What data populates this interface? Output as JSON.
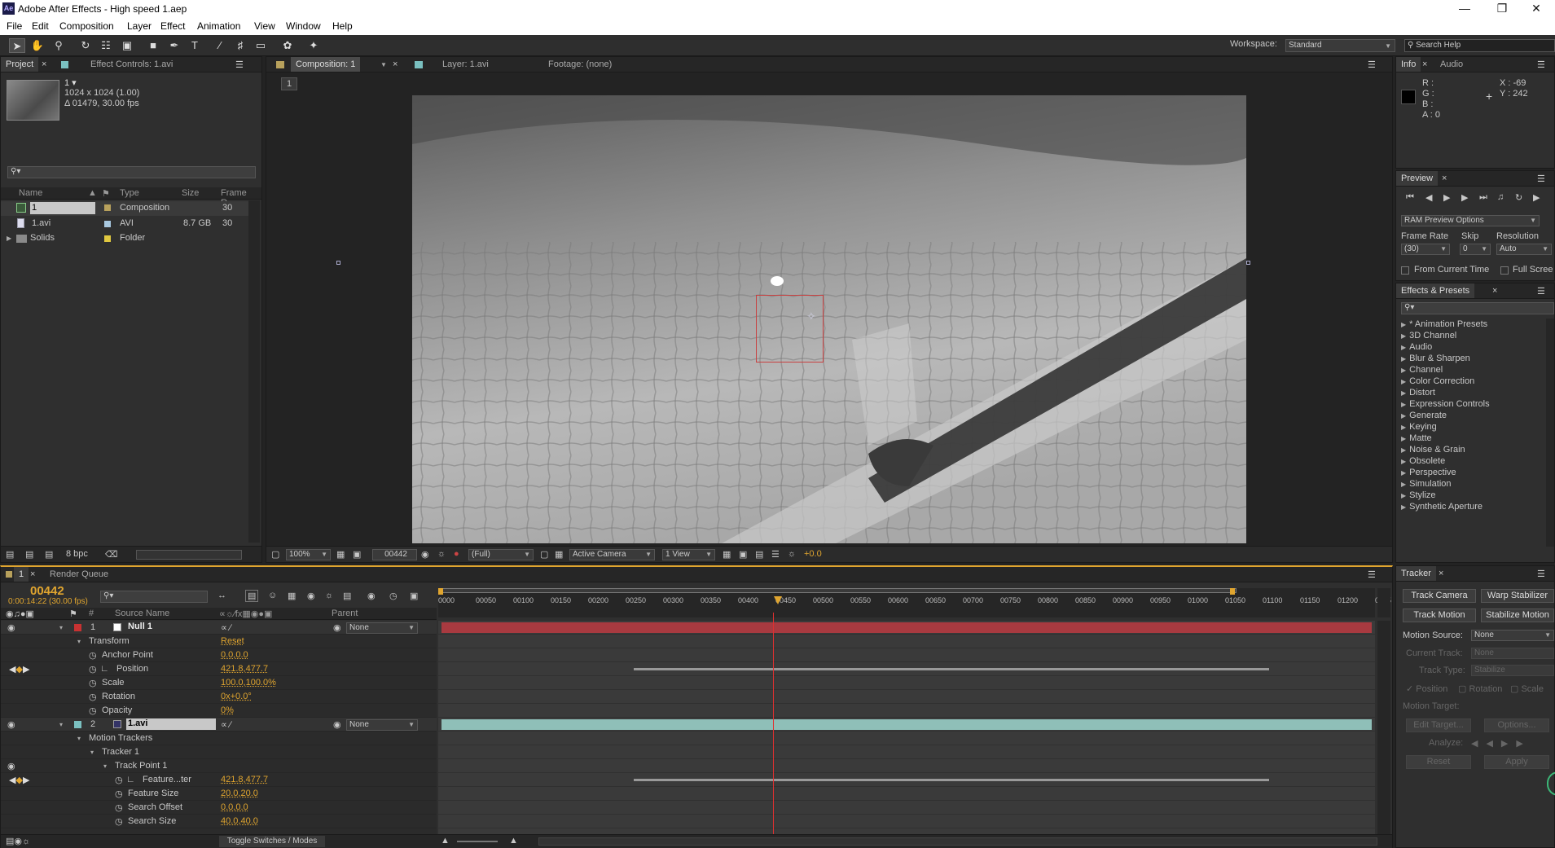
{
  "app": {
    "title": "Adobe After Effects - High speed 1.aep",
    "logo": "Ae"
  },
  "menu": [
    "File",
    "Edit",
    "Composition",
    "Layer",
    "Effect",
    "Animation",
    "View",
    "Window",
    "Help"
  ],
  "workspace": {
    "label": "Workspace:",
    "value": "Standard"
  },
  "search_help": {
    "placeholder": "Search Help"
  },
  "project": {
    "tab": "Project",
    "tab2": "Effect Controls: 1.avi",
    "name": "1 ▾",
    "dims": "1024 x 1024 (1.00)",
    "dur": "Δ 01479, 30.00 fps",
    "cols": [
      "Name",
      "Type",
      "Size",
      "Frame R..."
    ],
    "items": [
      {
        "name": "1",
        "type": "Composition",
        "size": "",
        "fr": "30",
        "color": "#b8a15c"
      },
      {
        "name": "1.avi",
        "type": "AVI",
        "size": "8.7 GB",
        "fr": "30",
        "color": "#a8c8e0"
      },
      {
        "name": "Solids",
        "type": "Folder",
        "size": "",
        "fr": "",
        "color": "#e0c840"
      }
    ],
    "bpc": "8 bpc"
  },
  "viewer": {
    "tab1": "Composition: 1",
    "tab2": "Layer: 1.avi",
    "tab3": "Footage: (none)",
    "crumb": "1",
    "zoom": "100%",
    "time": "00442",
    "res": "(Full)",
    "camera": "Active Camera",
    "views": "1 View",
    "offset": "+0.0"
  },
  "info": {
    "tab": "Info",
    "tab2": "Audio",
    "r": "R :",
    "g": "G :",
    "b": "B :",
    "a": "A : 0",
    "x": "X : -69",
    "y": "Y : 242"
  },
  "preview": {
    "tab": "Preview",
    "ram": "RAM Preview Options",
    "fr_label": "Frame Rate",
    "skip_label": "Skip",
    "res_label": "Resolution",
    "fr": "(30)",
    "skip": "0",
    "res": "Auto",
    "from_current": "From Current Time",
    "full_screen": "Full Screen"
  },
  "effects": {
    "tab": "Effects & Presets",
    "items": [
      "* Animation Presets",
      "3D Channel",
      "Audio",
      "Blur & Sharpen",
      "Channel",
      "Color Correction",
      "Distort",
      "Expression Controls",
      "Generate",
      "Keying",
      "Matte",
      "Noise & Grain",
      "Obsolete",
      "Perspective",
      "Simulation",
      "Stylize",
      "Synthetic Aperture"
    ]
  },
  "timeline": {
    "tab": "1",
    "tab2": "Render Queue",
    "time": "00442",
    "subtime": "0:00:14:22 (30.00 fps)",
    "col_hash": "#",
    "col_source": "Source Name",
    "col_parent": "Parent",
    "ruler": [
      "0000",
      "00050",
      "00100",
      "00150",
      "00200",
      "00250",
      "00300",
      "00350",
      "00400",
      "00450",
      "00500",
      "00550",
      "00600",
      "00650",
      "00700",
      "00750",
      "00800",
      "00850",
      "00900",
      "00950",
      "01000",
      "01050",
      "01100",
      "01150",
      "01200",
      "0125"
    ],
    "layers": [
      {
        "indent": 0,
        "num": "1",
        "name": "Null 1",
        "tri": "▾",
        "val": "",
        "parent": "None",
        "kind": "layer",
        "color": "#c83232"
      },
      {
        "indent": 1,
        "num": "",
        "name": "Transform",
        "tri": "▾",
        "val": "Reset",
        "kind": "group"
      },
      {
        "indent": 2,
        "num": "",
        "name": "Anchor Point",
        "tri": "",
        "val": "0.0,0.0",
        "kind": "prop"
      },
      {
        "indent": 2,
        "num": "",
        "name": "Position",
        "tri": "",
        "val": "421.8,477.7",
        "kind": "key"
      },
      {
        "indent": 2,
        "num": "",
        "name": "Scale",
        "tri": "",
        "val": "100.0,100.0%",
        "kind": "prop"
      },
      {
        "indent": 2,
        "num": "",
        "name": "Rotation",
        "tri": "",
        "val": "0x+0.0°",
        "kind": "prop"
      },
      {
        "indent": 2,
        "num": "",
        "name": "Opacity",
        "tri": "",
        "val": "0%",
        "kind": "prop"
      },
      {
        "indent": 0,
        "num": "2",
        "name": "1.avi",
        "tri": "▾",
        "val": "",
        "parent": "None",
        "kind": "layer",
        "color": "#7ac0c0"
      },
      {
        "indent": 1,
        "num": "",
        "name": "Motion Trackers",
        "tri": "▾",
        "val": "",
        "kind": "group"
      },
      {
        "indent": 2,
        "num": "",
        "name": "Tracker 1",
        "tri": "▾",
        "val": "",
        "kind": "group"
      },
      {
        "indent": 3,
        "num": "",
        "name": "Track Point 1",
        "tri": "▾",
        "val": "",
        "kind": "group"
      },
      {
        "indent": 4,
        "num": "",
        "name": "Feature...ter",
        "tri": "",
        "val": "421.8,477.7",
        "kind": "key"
      },
      {
        "indent": 4,
        "num": "",
        "name": "Feature Size",
        "tri": "",
        "val": "20.0,20.0",
        "kind": "prop"
      },
      {
        "indent": 4,
        "num": "",
        "name": "Search Offset",
        "tri": "",
        "val": "0.0,0.0",
        "kind": "prop"
      },
      {
        "indent": 4,
        "num": "",
        "name": "Search Size",
        "tri": "",
        "val": "40.0,40.0",
        "kind": "prop"
      }
    ],
    "toggle": "Toggle Switches / Modes"
  },
  "tracker": {
    "tab": "Tracker",
    "track_camera": "Track Camera",
    "warp": "Warp Stabilizer",
    "track_motion": "Track Motion",
    "stabilize": "Stabilize Motion",
    "source_label": "Motion Source:",
    "source": "None",
    "current_label": "Current Track:",
    "current": "None",
    "type_label": "Track Type:",
    "type": "Stabilize",
    "position": "Position",
    "rotation": "Rotation",
    "scale": "Scale",
    "target_label": "Motion Target:",
    "edit_target": "Edit Target...",
    "options": "Options...",
    "analyze": "Analyze:",
    "reset": "Reset",
    "apply": "Apply"
  }
}
